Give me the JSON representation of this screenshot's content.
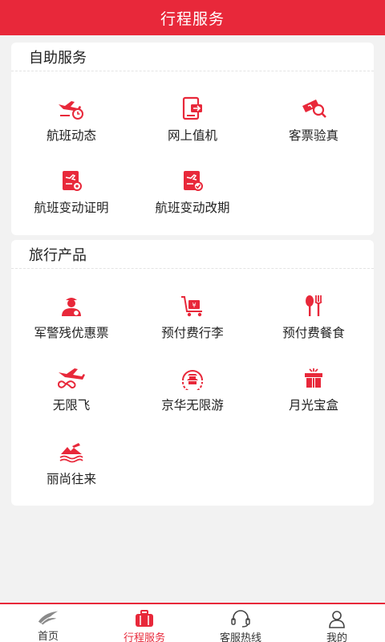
{
  "header": {
    "title": "行程服务"
  },
  "accent": "#e8283a",
  "sections": [
    {
      "title": "自助服务",
      "items": [
        {
          "label": "航班动态",
          "icon": "flight-clock-icon"
        },
        {
          "label": "网上值机",
          "icon": "checkin-device-icon"
        },
        {
          "label": "客票验真",
          "icon": "ticket-verify-icon"
        },
        {
          "label": "航班变动证明",
          "icon": "flight-certificate-icon"
        },
        {
          "label": "航班变动改期",
          "icon": "flight-reschedule-icon"
        }
      ]
    },
    {
      "title": "旅行产品",
      "items": [
        {
          "label": "军警残优惠票",
          "icon": "officer-icon"
        },
        {
          "label": "预付费行李",
          "icon": "luggage-cart-icon"
        },
        {
          "label": "预付费餐食",
          "icon": "utensils-icon"
        },
        {
          "label": "无限飞",
          "icon": "infinity-plane-icon"
        },
        {
          "label": "京华无限游",
          "icon": "temple-badge-icon"
        },
        {
          "label": "月光宝盒",
          "icon": "gift-box-icon"
        },
        {
          "label": "丽尚往来",
          "icon": "mountain-sea-icon"
        }
      ]
    }
  ],
  "tabs": [
    {
      "label": "首页",
      "icon": "home-logo-icon",
      "active": false
    },
    {
      "label": "行程服务",
      "icon": "suitcase-icon",
      "active": true
    },
    {
      "label": "客服热线",
      "icon": "headset-icon",
      "active": false
    },
    {
      "label": "我的",
      "icon": "user-icon",
      "active": false
    }
  ]
}
